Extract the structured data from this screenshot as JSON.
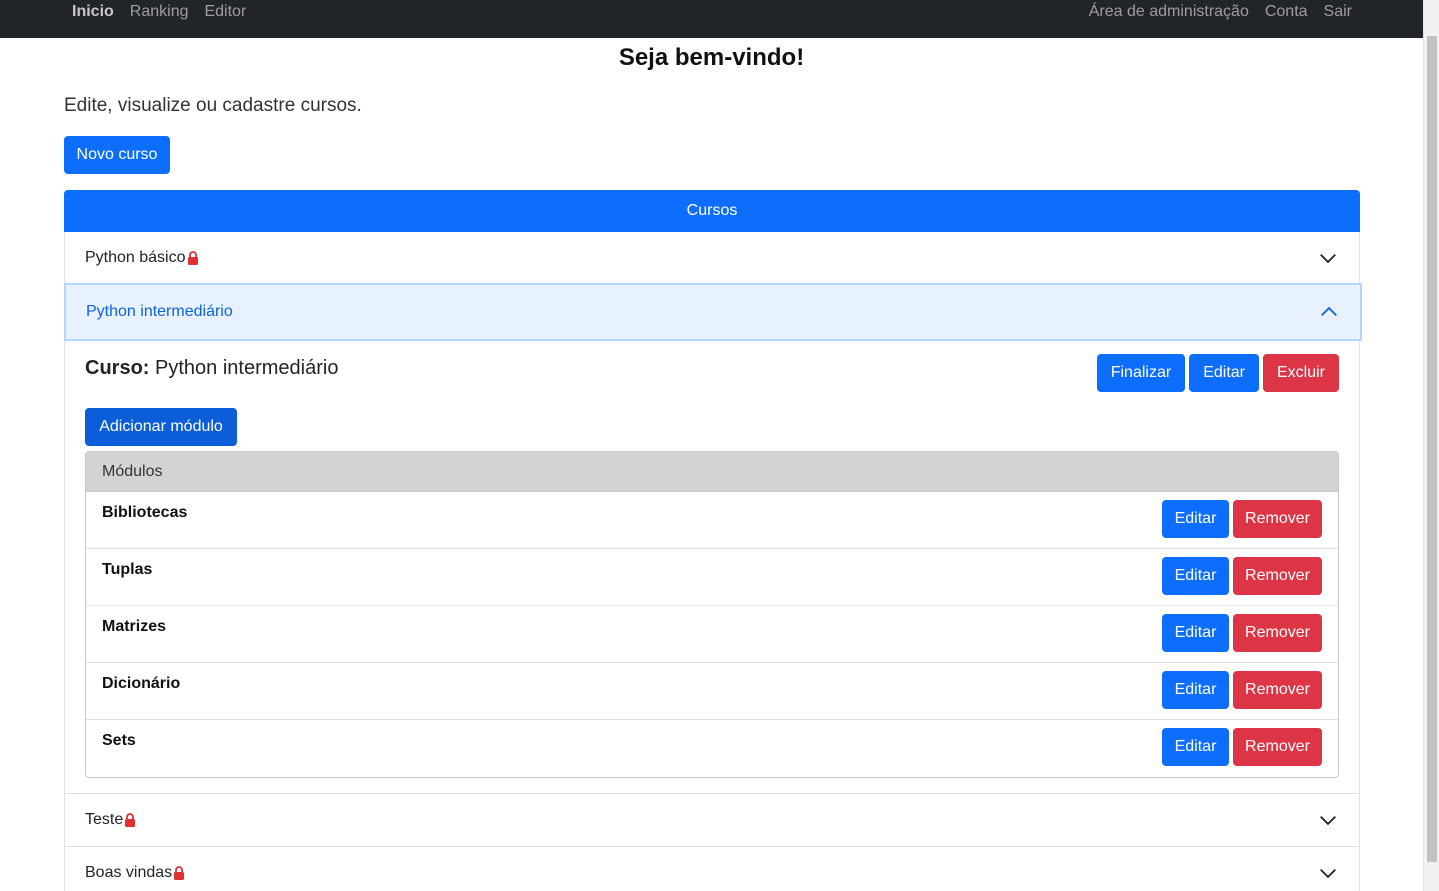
{
  "navbar": {
    "left_links": [
      "Inicio",
      "Ranking",
      "Editor"
    ],
    "right_links": [
      "Área de administração",
      "Conta",
      "Sair"
    ]
  },
  "page": {
    "title": "Seja bem-vindo!",
    "subtitle": "Edite, visualize ou cadastre cursos.",
    "new_course_label": "Novo curso"
  },
  "courses": {
    "header": "Cursos",
    "items": [
      {
        "name": "Python básico",
        "locked": true,
        "expanded": false
      },
      {
        "name": "Python intermediário",
        "locked": false,
        "expanded": true
      },
      {
        "name": "Teste",
        "locked": true,
        "expanded": false
      },
      {
        "name": "Boas vindas",
        "locked": true,
        "expanded": false
      }
    ],
    "open_course": {
      "label_prefix": "Curso:",
      "name": "Python intermediário",
      "finalize_label": "Finalizar",
      "edit_label": "Editar",
      "delete_label": "Excluir",
      "add_module_label": "Adicionar módulo",
      "modules_header": "Módulos",
      "modules": [
        {
          "name": "Bibliotecas",
          "edit_label": "Editar",
          "remove_label": "Remover"
        },
        {
          "name": "Tuplas",
          "edit_label": "Editar",
          "remove_label": "Remover"
        },
        {
          "name": "Matrizes",
          "edit_label": "Editar",
          "remove_label": "Remover"
        },
        {
          "name": "Dicionário",
          "edit_label": "Editar",
          "remove_label": "Remover"
        },
        {
          "name": "Sets",
          "edit_label": "Editar",
          "remove_label": "Remover"
        }
      ]
    }
  },
  "colors": {
    "primary": "#0d6efd",
    "danger": "#dc3545",
    "navbar": "#212529",
    "lock": "#e03131"
  },
  "icons": {
    "lock": "lock-icon",
    "chevron_down": "chevron-down-icon",
    "chevron_up": "chevron-up-icon"
  }
}
